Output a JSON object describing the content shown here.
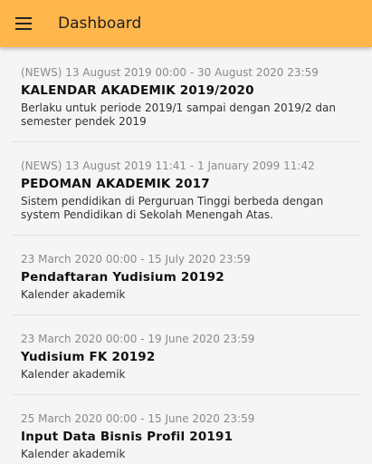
{
  "appbar": {
    "title": "Dashboard",
    "menu_icon": "hamburger-menu-icon",
    "color": "#ffb74d"
  },
  "announcements": [
    {
      "date": "(NEWS) 13 August 2019 00:00 - 30 August 2020 23:59",
      "title": "KALENDAR AKADEMIK 2019/2020",
      "description": "Berlaku untuk periode 2019/1 sampai dengan 2019/2 dan semester pendek 2019"
    },
    {
      "date": "(NEWS) 13 August 2019 11:41 - 1 January 2099 11:42",
      "title": "PEDOMAN AKADEMIK 2017",
      "description": "Sistem pendidikan di Perguruan Tinggi berbeda dengan system Pendidikan di Sekolah Menengah Atas."
    },
    {
      "date": "23 March 2020 00:00 - 15 July 2020 23:59",
      "title": "Pendaftaran Yudisium 20192",
      "description": "Kalender akademik"
    },
    {
      "date": "23 March 2020 00:00 - 19 June 2020 23:59",
      "title": "Yudisium FK 20192",
      "description": "Kalender akademik"
    },
    {
      "date": "25 March 2020 00:00 - 15 June 2020 23:59",
      "title": "Input Data Bisnis Profil 20191",
      "description": "Kalender akademik"
    }
  ]
}
